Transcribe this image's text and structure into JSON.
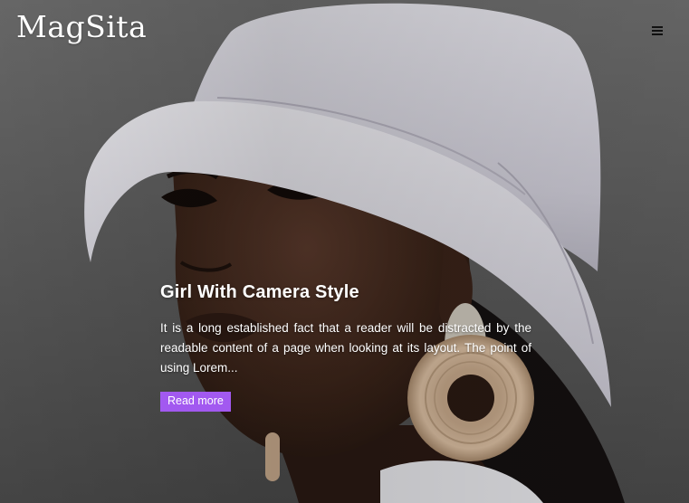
{
  "header": {
    "site_title": "MagSita",
    "menu_icon": "hamburger-menu-icon"
  },
  "hero": {
    "image_subject": "woman in white bucket hat with large wooden hoop earrings",
    "post": {
      "title": "Girl With Camera Style",
      "excerpt": "It is a long established fact that a reader will be distracted by the readable content of a page when looking at its layout. The point of using Lorem...",
      "read_more_label": "Read more"
    }
  },
  "colors": {
    "accent": "#a259f0",
    "text": "#ffffff",
    "menu_icon": "#111111"
  }
}
